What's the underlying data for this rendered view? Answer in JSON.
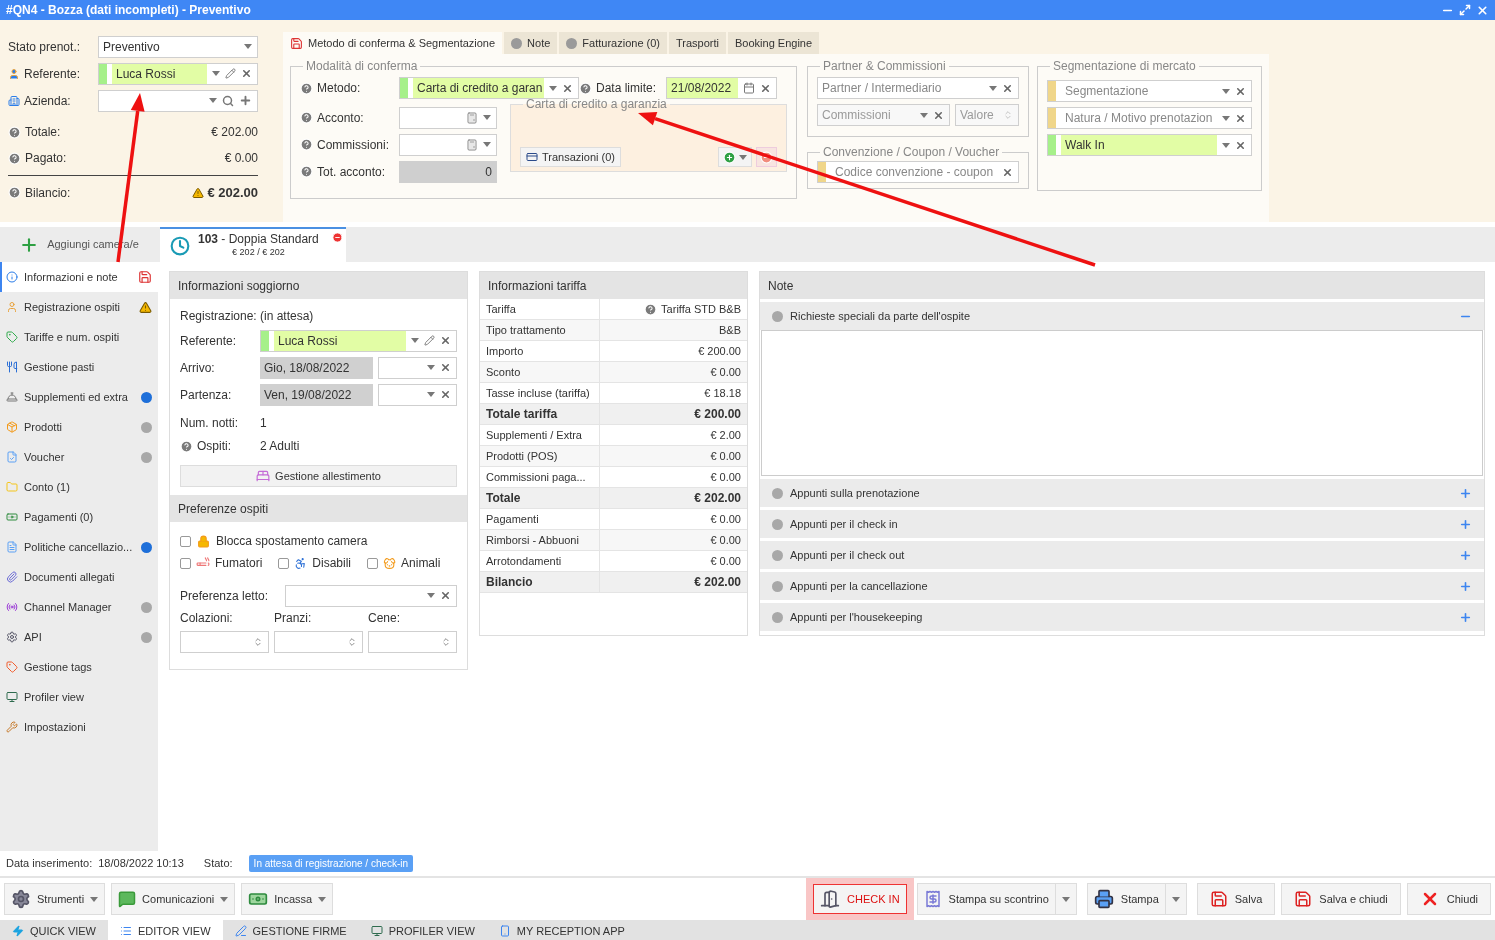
{
  "window": {
    "title": "#QN4 - Bozza (dati incompleti) - Preventivo"
  },
  "summary": {
    "fields": [
      {
        "kind": "select",
        "label": "Stato prenot.:",
        "value": "Preventivo"
      },
      {
        "kind": "person",
        "label": "Referente:",
        "value": "Luca Rossi"
      },
      {
        "kind": "company",
        "label": "Azienda:"
      }
    ],
    "totals": [
      {
        "label": "Totale:",
        "value": "€ 202.00",
        "warning": false
      },
      {
        "label": "Pagato:",
        "value": "€ 0.00",
        "warning": false
      },
      {
        "label": "Bilancio:",
        "value": "€ 202.00",
        "warning": true
      }
    ]
  },
  "top_tabs": [
    {
      "label": "Metodo di conferma & Segmentazione",
      "kind": "warning",
      "selected": true
    },
    {
      "label": "Note",
      "kind": "dot",
      "selected": false
    },
    {
      "label": "Fatturazione (0)",
      "kind": "dot",
      "selected": false
    },
    {
      "label": "Trasporti",
      "kind": "plain",
      "selected": false
    },
    {
      "label": "Booking Engine",
      "kind": "plain",
      "selected": false
    }
  ],
  "conferma": {
    "title": "Modalità di conferma",
    "metodo_label": "Metodo:",
    "metodo": "Carta di credito a garan",
    "data_label": "Data limite:",
    "data": "21/08/2022",
    "acconto_label": "Acconto:",
    "commissioni_label": "Commissioni:",
    "tot_label": "Tot. acconto:",
    "tot": "0",
    "card_title": "Carta di credito a garanzia",
    "transazioni": "Transazioni (0)"
  },
  "partner": {
    "title": "Partner & Commissioni",
    "partner_placeholder": "Partner / Intermediario",
    "commissioni_placeholder": "Commissioni",
    "valore_placeholder": "Valore"
  },
  "convenzione": {
    "title": "Convenzione / Coupon / Voucher",
    "placeholder": "Codice convenzione - coupon"
  },
  "segmentazione": {
    "title": "Segmentazione di mercato",
    "fields": [
      {
        "placeholder": "Segmentazione",
        "color": "#f0d68a"
      },
      {
        "placeholder": "Natura / Motivo prenotazion",
        "color": "#f0d68a"
      },
      {
        "value": "Walk In",
        "color": "#a6f08a"
      }
    ]
  },
  "add_room": "Aggiungi camera/e",
  "room_tab": {
    "title": "**103** - Doppia Standard",
    "price": "€ 202 / € 202"
  },
  "sidebar": [
    {
      "label": "Informazioni e note",
      "selected": true,
      "kind": "save-warning"
    },
    {
      "label": "Registrazione ospiti",
      "selected": false,
      "kind": "clock-warning"
    },
    {
      "label": "Tariffe e num. ospiti",
      "selected": false
    },
    {
      "label": "Gestione pasti",
      "selected": false
    },
    {
      "label": "Supplementi ed extra",
      "selected": false,
      "color": "#1e6fd9"
    },
    {
      "label": "Prodotti",
      "selected": false,
      "color": "#a8a8a8"
    },
    {
      "label": "Voucher",
      "selected": false,
      "color": "#a8a8a8"
    },
    {
      "label": "Conto (1)",
      "selected": false
    },
    {
      "label": "Pagamenti (0)",
      "selected": false
    },
    {
      "label": "Politiche cancellazio...",
      "selected": false,
      "color": "#1e6fd9"
    },
    {
      "label": "Documenti allegati",
      "selected": false
    },
    {
      "label": "Channel Manager",
      "selected": false,
      "color": "#a8a8a8"
    },
    {
      "label": "API",
      "selected": false,
      "color": "#a8a8a8"
    },
    {
      "label": "Gestione tags",
      "selected": false
    },
    {
      "label": "Profiler view",
      "selected": false
    },
    {
      "label": "Impostazioni",
      "selected": false
    }
  ],
  "soggiorno": {
    "title": "Informazioni soggiorno",
    "registrazione_label": "Registrazione:",
    "registrazione": "(in attesa)",
    "referente_label": "Referente:",
    "referente": "Luca Rossi",
    "arrivo_label": "Arrivo:",
    "arrivo": "Gio, 18/08/2022",
    "partenza_label": "Partenza:",
    "partenza": "Ven, 19/08/2022",
    "notti_label": "Num. notti:",
    "notti": "1",
    "ospiti_label": "Ospiti:",
    "ospiti": "2 Adulti",
    "allestimento": "Gestione allestimento"
  },
  "preferenze": {
    "title": "Preferenze ospiti",
    "checks": [
      {
        "label": "Blocca spostamento camera",
        "checked": false
      },
      {
        "label": "Fumatori",
        "checked": false
      },
      {
        "label": "Disabili",
        "checked": false
      },
      {
        "label": "Animali",
        "checked": false
      }
    ],
    "letto_label": "Preferenza letto:",
    "pasti": [
      "Colazioni:",
      "Pranzi:",
      "Cene:"
    ]
  },
  "tariffa": {
    "title": "Informazioni tariffa",
    "rows": [
      {
        "label": "Tariffa",
        "value": "Tariffa STD B&B",
        "bold": false
      },
      {
        "label": "Tipo trattamento",
        "value": "B&B",
        "bold": false
      },
      {
        "label": "Importo",
        "value": "€ 200.00",
        "bold": false
      },
      {
        "label": "Sconto",
        "value": "€ 0.00",
        "bold": false
      },
      {
        "label": "Tasse incluse (tariffa)",
        "value": "€ 18.18",
        "bold": false
      },
      {
        "label": "Totale tariffa",
        "value": "€ 200.00",
        "bold": true
      },
      {
        "label": "Supplementi / Extra",
        "value": "€ 2.00",
        "bold": false
      },
      {
        "label": "Prodotti (POS)",
        "value": "€ 0.00",
        "bold": false
      },
      {
        "label": "Commissioni paga...",
        "value": "€ 0.00",
        "bold": false
      },
      {
        "label": "Totale",
        "value": "€ 202.00",
        "bold": true
      },
      {
        "label": "Pagamenti",
        "value": "€ 0.00",
        "bold": false
      },
      {
        "label": "Rimborsi - Abbuoni",
        "value": "€ 0.00",
        "bold": false
      },
      {
        "label": "Arrotondamenti",
        "value": "€ 0.00",
        "bold": false
      },
      {
        "label": "Bilancio",
        "value": "€ 202.00",
        "bold": true
      }
    ]
  },
  "note": {
    "title": "Note",
    "sections": [
      {
        "label": "Richieste speciali da parte dell'ospite",
        "expanded": true
      },
      {
        "label": "Appunti sulla prenotazione",
        "expanded": false
      },
      {
        "label": "Appunti per il check in",
        "expanded": false
      },
      {
        "label": "Appunti per il check out",
        "expanded": false
      },
      {
        "label": "Appunti per la cancellazione",
        "expanded": false
      },
      {
        "label": "Appunti per l'housekeeping",
        "expanded": false
      }
    ]
  },
  "status": {
    "data_label": "Data inserimento:",
    "data": "18/08/2022 10:13",
    "stato_label": "Stato:",
    "stato": "In attesa di registrazione / check-in"
  },
  "toolbar_left": [
    {
      "label": "Strumenti"
    },
    {
      "label": "Comunicazioni"
    },
    {
      "label": "Incassa"
    }
  ],
  "toolbar_right": [
    {
      "label": "CHECK IN",
      "kind": "checkin"
    },
    {
      "label": "Stampa su scontrino",
      "kind": "receipt"
    },
    {
      "label": "Stampa",
      "kind": "print"
    },
    {
      "label": "Salva",
      "kind": "save"
    },
    {
      "label": "Salva e chiudi",
      "kind": "save"
    },
    {
      "label": "Chiudi",
      "kind": "close"
    }
  ],
  "view_tabs": [
    {
      "label": "QUICK VIEW",
      "selected": false
    },
    {
      "label": "EDITOR VIEW",
      "selected": true
    },
    {
      "label": "GESTIONE FIRME",
      "selected": false
    },
    {
      "label": "PROFILER VIEW",
      "selected": false
    },
    {
      "label": "MY RECEPTION APP",
      "selected": false
    }
  ]
}
